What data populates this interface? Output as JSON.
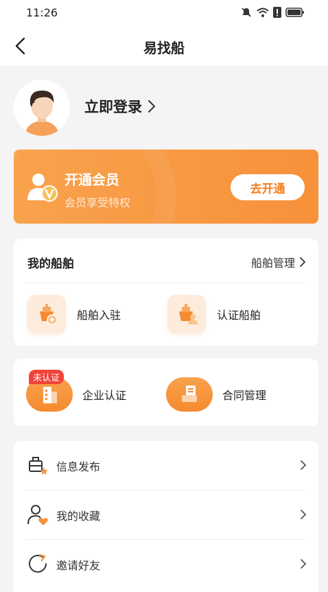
{
  "status_bar": {
    "time": "11:26"
  },
  "nav": {
    "title": "易找船"
  },
  "profile": {
    "login_label": "立即登录"
  },
  "vip": {
    "title": "开通会员",
    "subtitle": "会员享受特权",
    "button_label": "去开通"
  },
  "ships": {
    "title": "我的船舶",
    "manage_label": "船舶管理",
    "actions": [
      {
        "label": "船舶入驻",
        "icon": "ship-add-icon"
      },
      {
        "label": "认证船舶",
        "icon": "ship-verify-icon"
      }
    ]
  },
  "enterprise": {
    "actions": [
      {
        "label": "企业认证",
        "icon": "building-icon",
        "badge": "未认证"
      },
      {
        "label": "合同管理",
        "icon": "contract-icon"
      }
    ]
  },
  "menu": {
    "items": [
      {
        "label": "信息发布",
        "icon": "publish-icon"
      },
      {
        "label": "我的收藏",
        "icon": "favorite-user-icon"
      },
      {
        "label": "邀请好友",
        "icon": "invite-icon"
      }
    ]
  },
  "colors": {
    "accent": "#f7913a",
    "badge": "#f0443a"
  }
}
